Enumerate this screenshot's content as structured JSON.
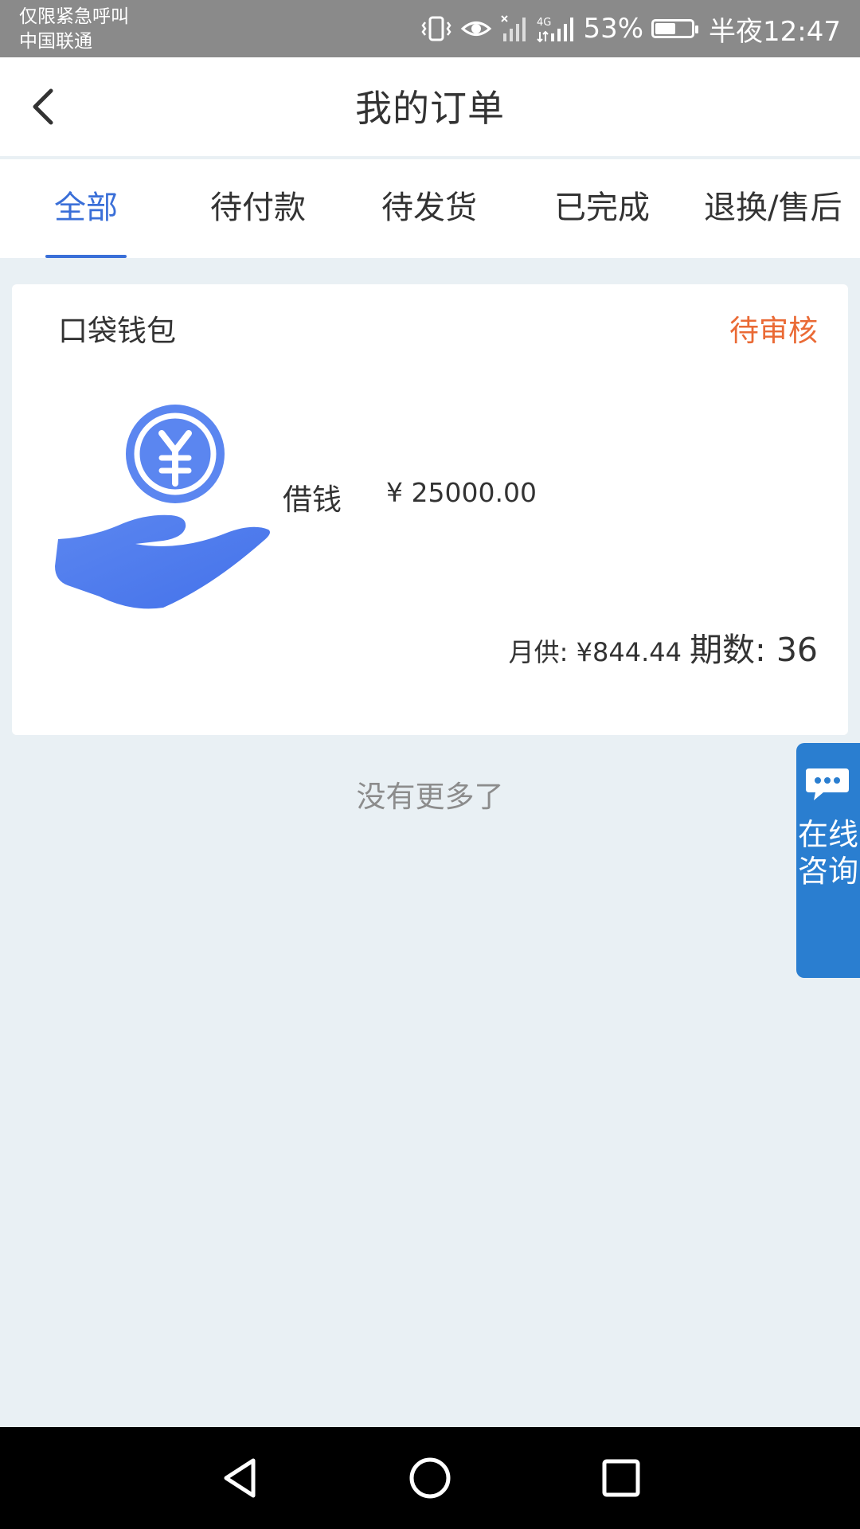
{
  "status_bar": {
    "line1": "仅限紧急呼叫",
    "line2": "中国联通",
    "battery_percent": "53%",
    "time": "半夜12:47"
  },
  "header": {
    "title": "我的订单"
  },
  "tabs": [
    {
      "label": "全部",
      "active": true
    },
    {
      "label": "待付款",
      "active": false
    },
    {
      "label": "待发货",
      "active": false
    },
    {
      "label": "已完成",
      "active": false
    },
    {
      "label": "退换/售后",
      "active": false
    }
  ],
  "orders": [
    {
      "merchant": "口袋钱包",
      "status": "待审核",
      "item_name": "借钱",
      "item_price": "¥ 25000.00",
      "monthly": "月供: ¥844.44",
      "periods": "期数: 36",
      "icon": "loan-hand-coin-icon"
    }
  ],
  "list_end": "没有更多了",
  "float_button": {
    "label": "在线咨询",
    "icon": "chat-bubble-icon"
  },
  "colors": {
    "accent": "#3a6fd8",
    "status_orange": "#ea6a35",
    "float_blue": "#2a7ed0",
    "background": "#e9f0f4"
  }
}
